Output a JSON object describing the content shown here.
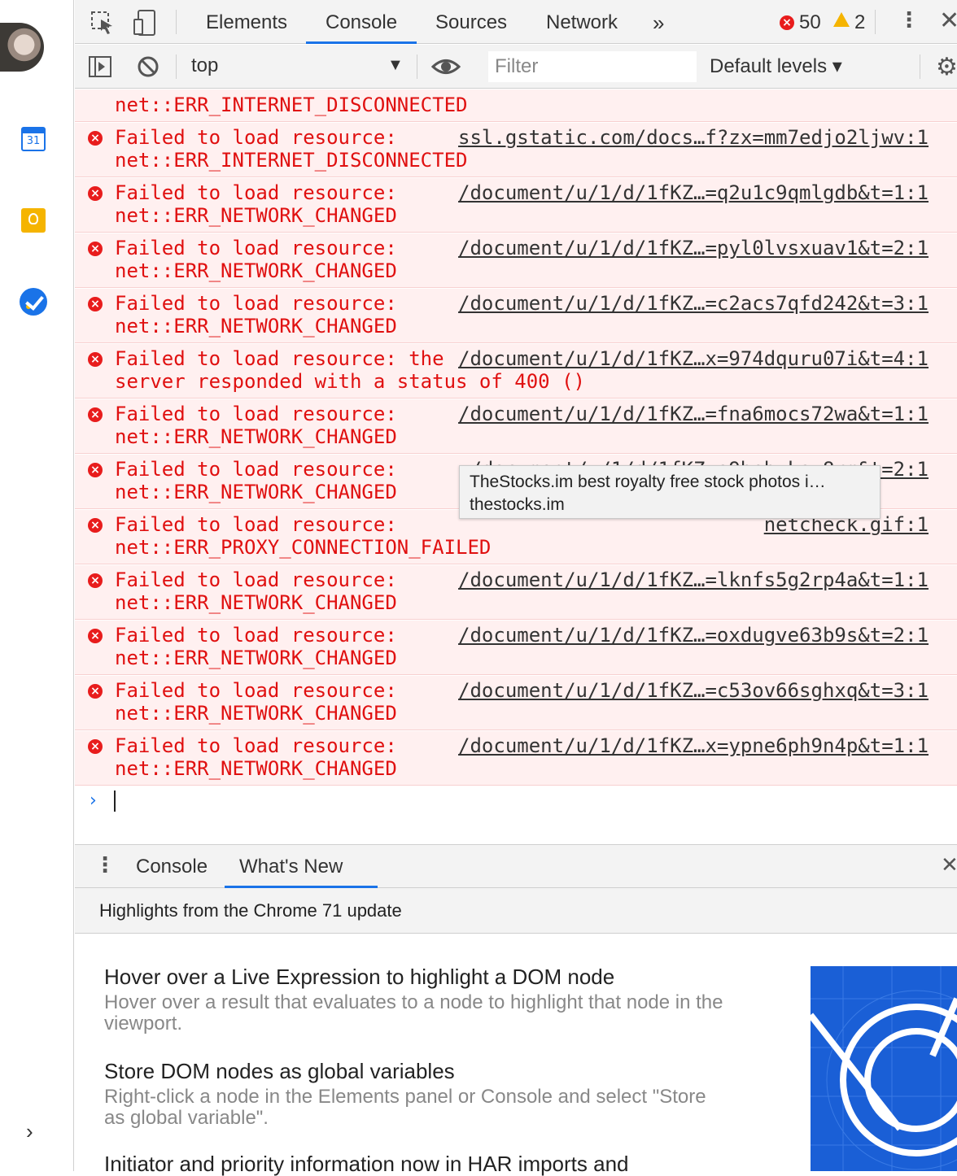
{
  "sidebar": {
    "calendar_day": "31"
  },
  "devtools": {
    "tabs": [
      "Elements",
      "Console",
      "Sources",
      "Network"
    ],
    "active_tab": "Console",
    "more_tabs_glyph": "»",
    "error_count": "50",
    "warning_count": "2"
  },
  "console_toolbar": {
    "context": "top",
    "filter_placeholder": "Filter",
    "levels": "Default levels"
  },
  "messages": [
    {
      "line1": "",
      "line2": "net::ERR_INTERNET_DISCONNECTED",
      "source": ""
    },
    {
      "line1": "Failed to load resource: ",
      "line2": "net::ERR_INTERNET_DISCONNECTED",
      "source": "ssl.gstatic.com/docs…f?zx=mm7edjo2ljwv:1"
    },
    {
      "line1": "Failed to load resource: ",
      "line2": "net::ERR_NETWORK_CHANGED",
      "source": "/document/u/1/d/1fKZ…=q2u1c9qmlgdb&t=1:1"
    },
    {
      "line1": "Failed to load resource: ",
      "line2": "net::ERR_NETWORK_CHANGED",
      "source": "/document/u/1/d/1fKZ…=pyl0lvsxuav1&t=2:1"
    },
    {
      "line1": "Failed to load resource: ",
      "line2": "net::ERR_NETWORK_CHANGED",
      "source": "/document/u/1/d/1fKZ…=c2acs7qfd242&t=3:1"
    },
    {
      "line1": "Failed to load resource: the",
      "line2": "server responded with a status of 400 ()",
      "source": "/document/u/1/d/1fKZ…x=974dquru07i&t=4:1"
    },
    {
      "line1": "Failed to load resource: ",
      "line2": "net::ERR_NETWORK_CHANGED",
      "source": "/document/u/1/d/1fKZ…=fna6mocs72wa&t=1:1"
    },
    {
      "line1": "Failed to load resource: ",
      "line2": "net::ERR_NETWORK_CHANGED",
      "source": "/document/u/1/d/1fKZ…s9bebvksy8rm&t=2:1"
    },
    {
      "line1": "Failed to load resource: ",
      "line2": "net::ERR_PROXY_CONNECTION_FAILED",
      "source": "netcheck.gif:1"
    },
    {
      "line1": "Failed to load resource: ",
      "line2": "net::ERR_NETWORK_CHANGED",
      "source": "/document/u/1/d/1fKZ…=lknfs5g2rp4a&t=1:1"
    },
    {
      "line1": "Failed to load resource: ",
      "line2": "net::ERR_NETWORK_CHANGED",
      "source": "/document/u/1/d/1fKZ…=oxdugve63b9s&t=2:1"
    },
    {
      "line1": "Failed to load resource: ",
      "line2": "net::ERR_NETWORK_CHANGED",
      "source": "/document/u/1/d/1fKZ…=c53ov66sghxq&t=3:1"
    },
    {
      "line1": "Failed to load resource: ",
      "line2": "net::ERR_NETWORK_CHANGED",
      "source": "/document/u/1/d/1fKZ…x=ypne6ph9n4p&t=1:1"
    }
  ],
  "tooltip": {
    "title": "TheStocks.im best royalty free stock photos i…",
    "url": "thestocks.im"
  },
  "drawer": {
    "tabs": [
      "Console",
      "What's New"
    ],
    "active_tab": "What's New",
    "header": "Highlights from the Chrome 71 update",
    "features": [
      {
        "title": "Hover over a Live Expression to highlight a DOM node",
        "desc": "Hover over a result that evaluates to a node to highlight that node in the viewport."
      },
      {
        "title": "Store DOM nodes as global variables",
        "desc": "Right-click a node in the Elements panel or Console and select \"Store as global variable\"."
      },
      {
        "title": "Initiator and priority information now in HAR imports and",
        "desc": ""
      }
    ]
  },
  "colors": {
    "error_text": "#e01010",
    "error_bg": "#fff0f0",
    "accent": "#1a73e8"
  }
}
